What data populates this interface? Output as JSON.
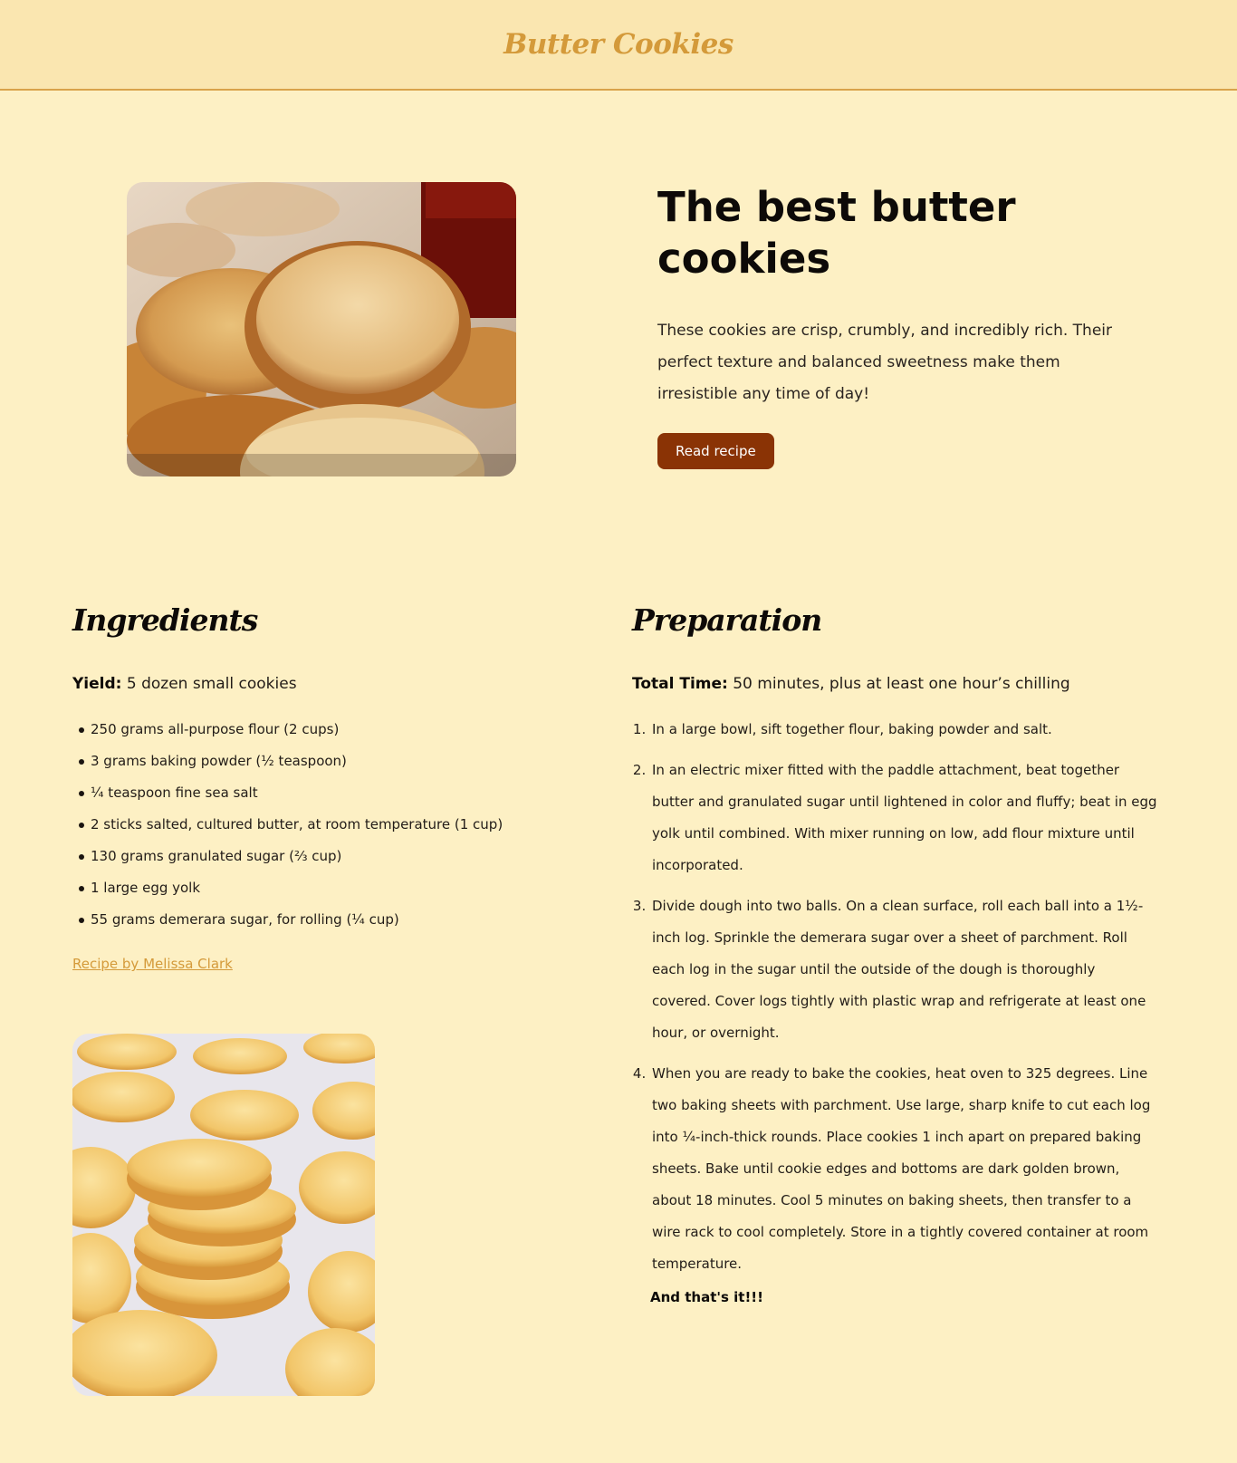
{
  "header": {
    "site_title": "Butter Cookies"
  },
  "hero": {
    "image_icon": "butter-cookies-photo",
    "title": "The best butter cookies",
    "description": "These cookies are crisp, crumbly, and incredibly rich. Their perfect texture and balanced sweetness make them irresistible any time of day!",
    "button_label": "Read recipe"
  },
  "ingredients": {
    "title": "Ingredients",
    "yield_label": "Yield:",
    "yield_value": " 5 dozen small cookies",
    "items": [
      "250 grams all-purpose flour (2 cups)",
      "3 grams baking powder (½ teaspoon)",
      "¼ teaspoon fine sea salt",
      "2 sticks salted, cultured butter, at room temperature (1 cup)",
      "130 grams granulated sugar (⅔ cup)",
      "1 large egg yolk",
      "55 grams demerara sugar, for rolling (¼ cup)"
    ],
    "credit_link": "Recipe by Melissa Clark",
    "image_icon": "stacked-cookies-photo"
  },
  "preparation": {
    "title": "Preparation",
    "time_label": "Total Time:",
    "time_value": " 50 minutes, plus at least one hour’s chilling",
    "steps": [
      "In a large bowl, sift together flour, baking powder and salt.",
      "In an electric mixer fitted with the paddle attachment, beat together butter and granulated sugar until lightened in color and fluffy; beat in egg yolk until combined. With mixer running on low, add flour mixture until incorporated.",
      "Divide dough into two balls. On a clean surface, roll each ball into a 1½-inch log. Sprinkle the demerara sugar over a sheet of parchment. Roll each log in the sugar until the outside of the dough is thoroughly covered. Cover logs tightly with plastic wrap and refrigerate at least one hour, or overnight.",
      "When you are ready to bake the cookies, heat oven to 325 degrees. Line two baking sheets with parchment. Use large, sharp knife to cut each log into ¼-inch-thick rounds. Place cookies 1 inch apart on prepared baking sheets. Bake until cookie edges and bottoms are dark golden brown, about 18 minutes. Cool 5 minutes on baking sheets, then transfer to a wire rack to cool completely. Store in a tightly covered container at room temperature."
    ],
    "closing": "And that's it!!!"
  }
}
